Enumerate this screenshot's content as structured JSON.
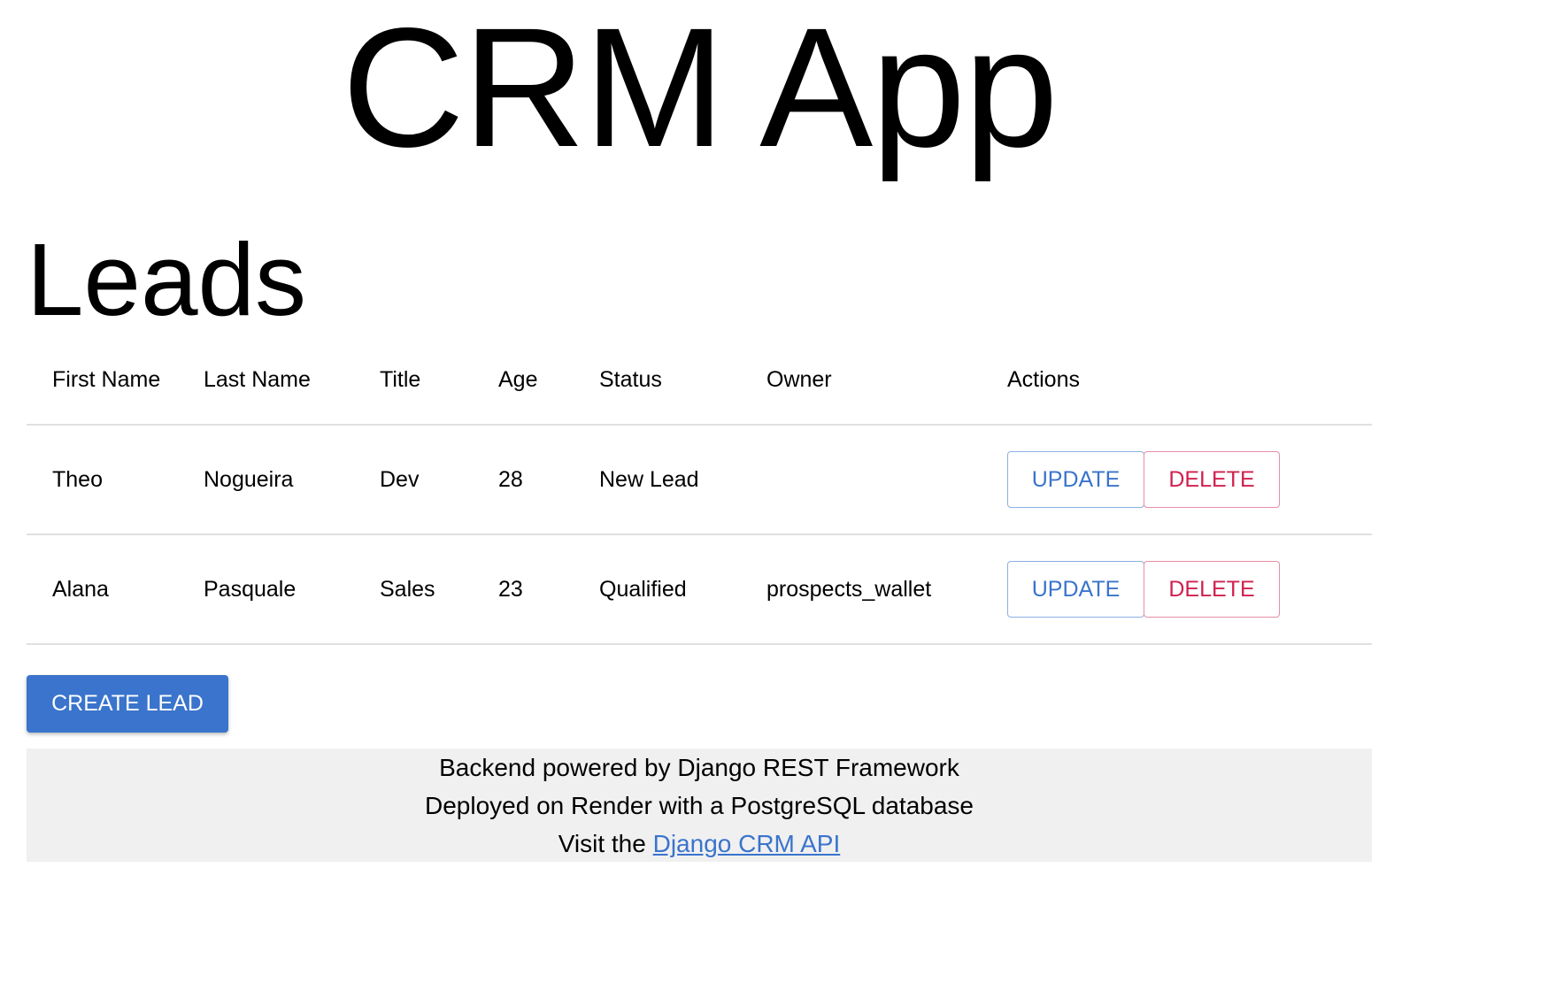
{
  "header": {
    "app_title": "CRM App"
  },
  "leads": {
    "title": "Leads",
    "columns": [
      "First Name",
      "Last Name",
      "Title",
      "Age",
      "Status",
      "Owner",
      "Actions"
    ],
    "rows": [
      {
        "first_name": "Theo",
        "last_name": "Nogueira",
        "title": "Dev",
        "age": "28",
        "status": "New Lead",
        "owner": "",
        "update_label": "UPDATE",
        "delete_label": "DELETE"
      },
      {
        "first_name": "Alana",
        "last_name": "Pasquale",
        "title": "Sales",
        "age": "23",
        "status": "Qualified",
        "owner": "prospects_wallet",
        "update_label": "UPDATE",
        "delete_label": "DELETE"
      }
    ],
    "create_label": "CREATE LEAD"
  },
  "footer": {
    "line1": "Backend powered by Django REST Framework",
    "line2": "Deployed on Render with a PostgreSQL database",
    "line3_prefix": "Visit the ",
    "link_text": "Django CRM API"
  },
  "colors": {
    "primary": "#3a74cc",
    "danger": "#d0214f",
    "footer_bg": "#f0f0f0",
    "divider": "#e0e0e0"
  }
}
